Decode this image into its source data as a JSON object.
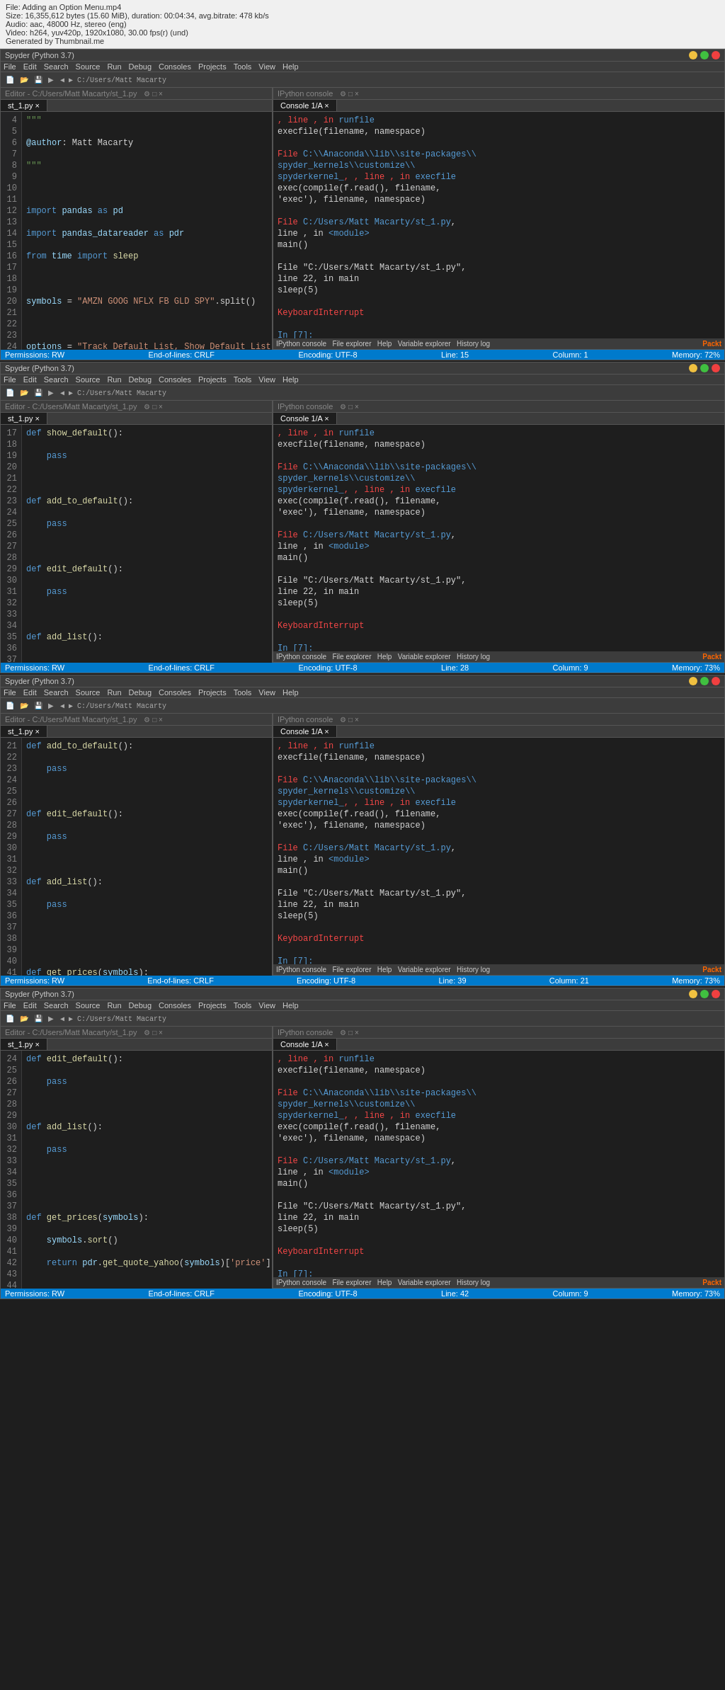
{
  "video_info": {
    "filename": "File: Adding an Option Menu.mp4",
    "size": "Size: 16,355,612 bytes (15.60 MiB), duration: 00:04:34, avg.bitrate: 478 kb/s",
    "audio": "Audio: aac, 48000 Hz, stereo (eng)",
    "video": "Video: h264, yuv420p, 1920x1080, 30.00 fps(r) (und)",
    "generated": "Generated by Thumbnail.me"
  },
  "windows": [
    {
      "title": "Spyder (Python 3.7)",
      "tab": "st_1.py",
      "status": "Permissions: RW  End-of-lines: CRLF  Encoding: UTF-8  Line: 15  Column: 1  Memory: 72%",
      "editor_filepath": "C:/Users/Matt Macarty",
      "console_title": "IPython console",
      "console_1a": "Console 1/A"
    },
    {
      "title": "Spyder (Python 3.7)",
      "tab": "st_1.py",
      "status": "Permissions: RW  End-of-lines: CRLF  Encoding: UTF-8  Line: 28  Column: 9  Memory: 73%",
      "editor_filepath": "C:/Users/Matt Macarty",
      "console_title": "IPython console",
      "console_1a": "Console 1/A"
    },
    {
      "title": "Spyder (Python 3.7)",
      "tab": "st_1.py",
      "status": "Permissions: RW  End-of-lines: CRLF  Encoding: UTF-8  Line: 39  Column: 21  Memory: 73%",
      "editor_filepath": "C:/Users/Matt Macarty",
      "console_title": "IPython console",
      "console_1a": "Console 1/A"
    },
    {
      "title": "Spyder (Python 3.7)",
      "tab": "st_1.py",
      "status": "Permissions: RW  End-of-lines: CRLF  Encoding: UTF-8  Line: 42  Column: 9  Memory: 73%",
      "editor_filepath": "C:/Users/Matt Macarty",
      "console_title": "IPython console",
      "console_1a": "Console 1/A"
    }
  ],
  "menubar_items": [
    "File",
    "Edit",
    "Search",
    "Source",
    "Run",
    "Debug",
    "Consoles",
    "Projects",
    "Tools",
    "View",
    "Help"
  ],
  "console_common": {
    "line1": "                     , line    , in runfile",
    "line2": "    execfile(filename, namespace)",
    "line3": "",
    "line4": "  File C:\\Anaconda\\lib\\site-packages\\",
    "line5": "spyder_kernels\\customize\\",
    "line6": "spyderkernel_,    , line    , in execfile",
    "line7": "    exec(compile(f.read(), filename,",
    "line8": "    'exec'), filename, namespace)",
    "line9": "",
    "line10": "  File C:/Users/Matt Macarty/st_1.py,",
    "line11": "  line   , in <module>",
    "line12": "    main()",
    "line13": "",
    "line14": "  File \"C:/Users/Matt Macarty/st_1.py\",",
    "line15": "line 22, in main",
    "line16": "    sleep(5)",
    "line17": "",
    "line18": "KeyboardInterrupt",
    "line19": "",
    "line20": "In [7]:",
    "line21": "",
    "line22": "In [7]:"
  }
}
